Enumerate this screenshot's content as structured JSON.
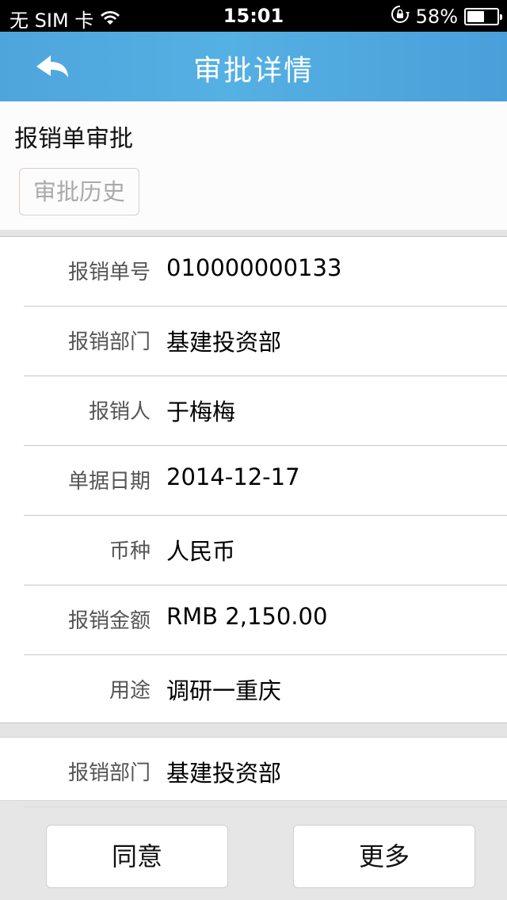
{
  "status_bar": {
    "carrier": "无 SIM 卡",
    "time": "15:01",
    "battery_percent": "58%",
    "battery_level": 0.58,
    "icons": [
      "wifi-icon",
      "rotation-lock-icon",
      "battery-icon"
    ]
  },
  "nav": {
    "title": "审批详情",
    "back_icon": "back-arrow-icon"
  },
  "header": {
    "title": "报销单审批",
    "history_button": "审批历史"
  },
  "details": [
    {
      "label": "报销单号",
      "value": "010000000133"
    },
    {
      "label": "报销部门",
      "value": "基建投资部"
    },
    {
      "label": "报销人",
      "value": "于梅梅"
    },
    {
      "label": "单据日期",
      "value": "2014-12-17"
    },
    {
      "label": "币种",
      "value": "人民币"
    },
    {
      "label": "报销金额",
      "value": "RMB 2,150.00"
    },
    {
      "label": "用途",
      "value": "调研一重庆"
    }
  ],
  "details2": [
    {
      "label": "报销部门",
      "value": "基建投资部"
    }
  ],
  "actions": {
    "agree": "同意",
    "more": "更多"
  },
  "colors": {
    "nav_bar": "#55b0e3",
    "background": "#e6e6e6"
  }
}
